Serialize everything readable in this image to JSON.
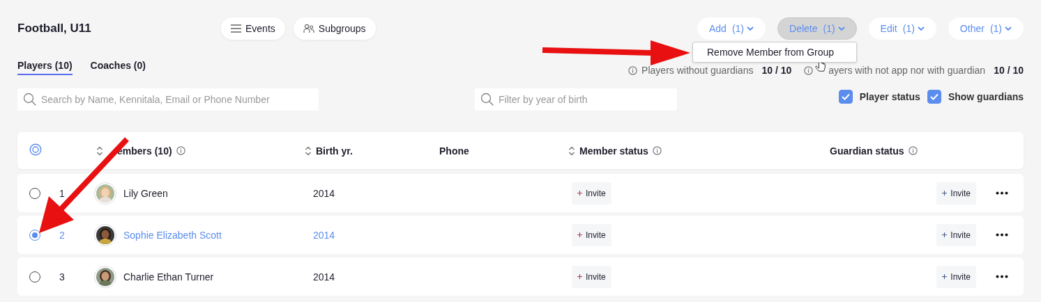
{
  "title": "Football, U11",
  "nav_buttons": [
    {
      "kind": "list",
      "label": "Events"
    },
    {
      "kind": "people",
      "label": "Subgroups"
    }
  ],
  "action_buttons": [
    {
      "label": "Add",
      "count": "(1)",
      "selected": false
    },
    {
      "label": "Delete",
      "count": "(1)",
      "selected": true
    },
    {
      "label": "Edit",
      "count": "(1)",
      "selected": false
    },
    {
      "label": "Other",
      "count": "(1)",
      "selected": false
    }
  ],
  "dropdown": {
    "items": [
      {
        "label": "Remove Member from Group"
      }
    ]
  },
  "tabs": [
    {
      "label": "Players (10)",
      "selected": true
    },
    {
      "label": "Coaches (0)",
      "selected": false
    }
  ],
  "stats": [
    {
      "label": "Players without guardians",
      "value": "10 / 10"
    },
    {
      "label": "ayers with not app nor with guardian",
      "value": "10 / 10"
    }
  ],
  "search": {
    "placeholder": "Search by Name, Kennitala, Email or Phone Number"
  },
  "year_filter": {
    "placeholder": "Filter by year of birth"
  },
  "toggles": [
    {
      "label": "Player status",
      "checked": true
    },
    {
      "label": "Show guardians",
      "checked": true
    }
  ],
  "table": {
    "columns": [
      {
        "label": "embers (10)",
        "sortable": true,
        "info": true
      },
      {
        "label": "Birth yr.",
        "sortable": true,
        "info": false
      },
      {
        "label": "Phone",
        "sortable": false,
        "info": false
      },
      {
        "label": "Member status",
        "sortable": true,
        "info": true
      },
      {
        "label": "Guardian status",
        "sortable": false,
        "info": true
      }
    ],
    "rows": [
      {
        "number": "1",
        "name": "Lily Green",
        "birth_year": "2014",
        "member_status": "Invite",
        "guardian_status": "Invite",
        "selected": false
      },
      {
        "number": "2",
        "name": "Sophie Elizabeth Scott",
        "birth_year": "2014",
        "member_status": "Invite",
        "guardian_status": "Invite",
        "selected": true
      },
      {
        "number": "3",
        "name": "Charlie Ethan Turner",
        "birth_year": "2014",
        "member_status": "Invite",
        "guardian_status": "Invite",
        "selected": false
      }
    ]
  }
}
